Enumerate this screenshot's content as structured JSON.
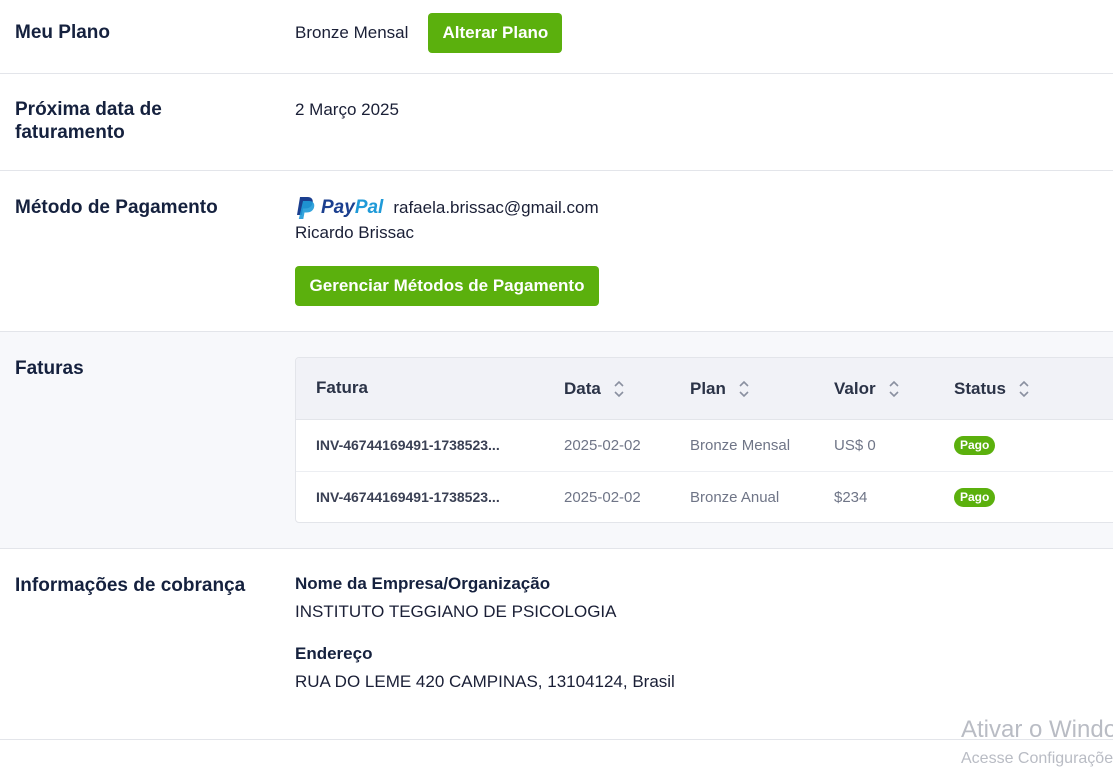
{
  "plan": {
    "label": "Meu Plano",
    "value": "Bronze Mensal",
    "change_button": "Alterar Plano"
  },
  "billing_date": {
    "label": "Próxima data de faturamento",
    "value": "2 Março 2025"
  },
  "payment": {
    "label": "Método de Pagamento",
    "provider_word_1": "Pay",
    "provider_word_2": "Pal",
    "email": "rafaela.brissac@gmail.com",
    "name": "Ricardo Brissac",
    "manage_button": "Gerenciar Métodos de Pagamento"
  },
  "invoices": {
    "label": "Faturas",
    "columns": [
      "Fatura",
      "Data",
      "Plan",
      "Valor",
      "Status"
    ],
    "rows": [
      {
        "id": "INV-46744169491-1738523...",
        "date": "2025-02-02",
        "plan": "Bronze Mensal",
        "value": "US$ 0",
        "status": "Pago"
      },
      {
        "id": "INV-46744169491-1738523...",
        "date": "2025-02-02",
        "plan": "Bronze Anual",
        "value": "$234",
        "status": "Pago"
      }
    ]
  },
  "billing_info": {
    "label": "Informações de cobrança",
    "company_title": "Nome da Empresa/Organização",
    "company_value": "INSTITUTO TEGGIANO DE PSICOLOGIA",
    "address_title": "Endereço",
    "address_value": "RUA DO LEME 420 CAMPINAS, 13104124, Brasil"
  },
  "watermark": {
    "line1": "Ativar o Windows",
    "line2": "Acesse Configurações"
  },
  "colors": {
    "accent": "#5bb00d",
    "paypal_dark": "#1b3f8f",
    "paypal_light": "#1f9ad8"
  }
}
